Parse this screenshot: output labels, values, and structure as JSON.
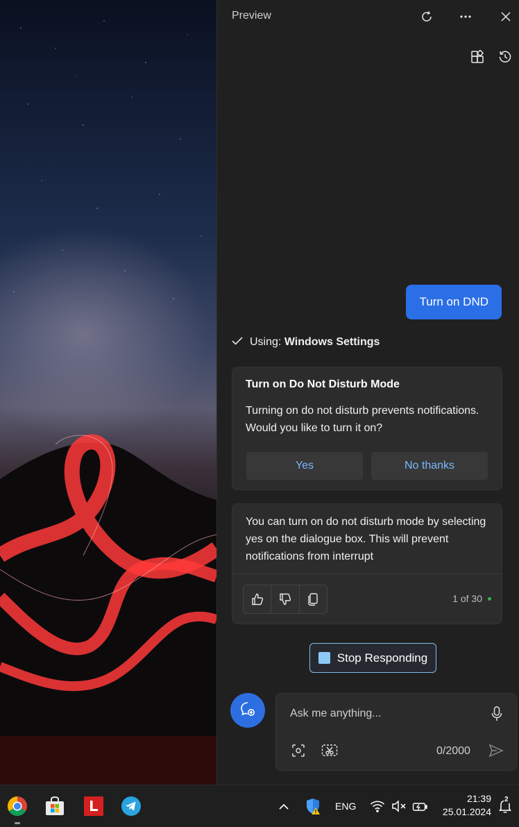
{
  "window": {
    "title": "Preview"
  },
  "conversation": {
    "user_message": "Turn on DND",
    "using_prefix": "Using:",
    "using_source": "Windows Settings"
  },
  "dnd_card": {
    "title": "Turn on Do Not Disturb Mode",
    "body": "Turning on do not disturb prevents notifications. Would you like to turn it on?",
    "yes_label": "Yes",
    "no_label": "No thanks"
  },
  "response": {
    "text": "You can turn on do not disturb mode by selecting yes on the dialogue box. This will prevent notifications from interrupt",
    "counter": "1 of 30"
  },
  "stop_label": "Stop Responding",
  "composer": {
    "placeholder": "Ask me anything...",
    "char_count": "0/2000"
  },
  "taskbar": {
    "language": "ENG",
    "time": "21:39",
    "date": "25.01.2024",
    "notification_count": "2"
  },
  "colors": {
    "accent": "#2b6fe6",
    "link": "#7ab8ff",
    "stop_border": "#7fbcec",
    "status_dot": "#38b24a"
  }
}
